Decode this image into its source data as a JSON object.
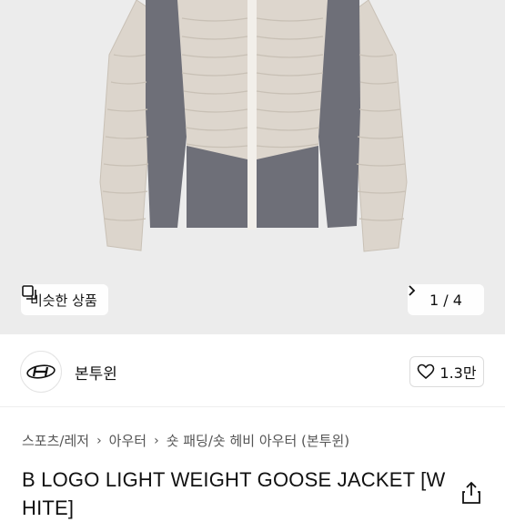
{
  "product": {
    "image_alt": "light beige and grey goose down jacket",
    "similar_label": "비슷한 상품",
    "pager": {
      "current": "1",
      "separator": "/",
      "total": "4"
    }
  },
  "seller": {
    "name": "본투윈",
    "likes": "1.3만"
  },
  "breadcrumb": [
    "스포츠/레저",
    "아우터",
    "숏 패딩/숏 헤비 아우터 (본투윈)"
  ],
  "title": "B LOGO LIGHT WEIGHT GOOSE JACKET [WHITE]",
  "colors": {
    "jacket_body": "#ddd6cd",
    "jacket_panel": "#6e6f78",
    "background": "#ececec"
  }
}
